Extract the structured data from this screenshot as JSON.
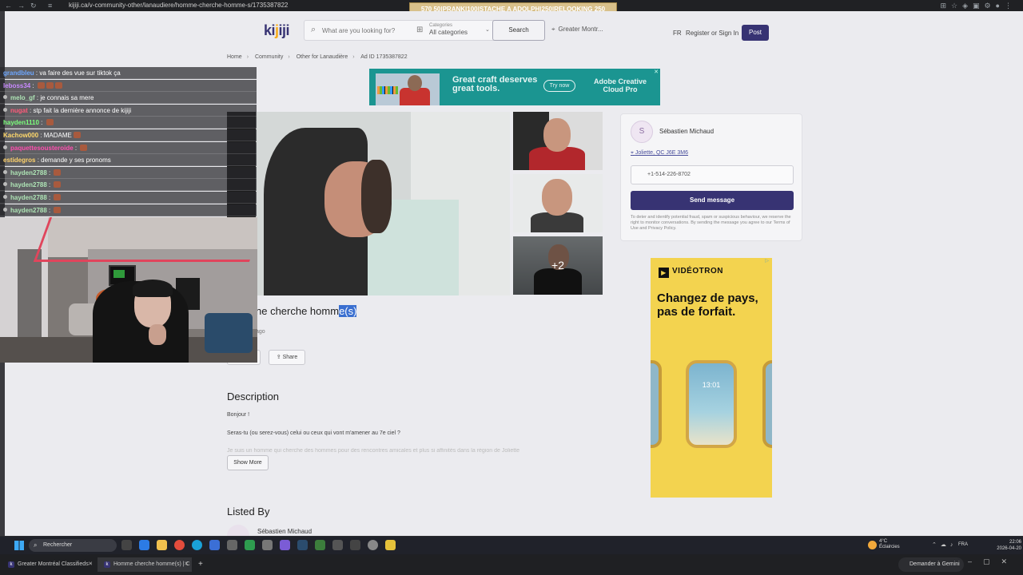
{
  "browser": {
    "url": "kijiji.ca/v-community-other/lanaudiere/homme-cherche-homme-s/1735387822",
    "overlay_text": "570        50|PRANK|100|STACHE A ADOLPH|250|RELOOKING 250"
  },
  "header": {
    "logo": [
      "ki",
      "j",
      "iji"
    ],
    "search_placeholder": "What are you looking for?",
    "categories_label": "Categories",
    "categories_value": "All categories",
    "search_button": "Search",
    "location": "Greater Montr...",
    "lang": "FR",
    "register": "Register or Sign In",
    "post": "Post"
  },
  "breadcrumb": [
    "Home",
    "Community",
    "Other for Lanaudière",
    "Ad ID 1735387822"
  ],
  "adobe_ad": {
    "headline": "Great craft deserves great tools.",
    "cta": "Try now",
    "brand": "Adobe Creative Cloud Pro"
  },
  "gallery": {
    "more_count": "+2"
  },
  "seller": {
    "initial": "S",
    "name": "Sébastien Michaud",
    "location": "Joliette, QC J6E 3M6",
    "phone": "+1-514-226-8702",
    "send_button": "Send message",
    "disclaimer": "To deter and identify potential fraud, spam or suspicious behaviour, we reserve the right to monitor conversations. By sending the message you agree to our Terms of Use and Privacy Policy."
  },
  "videotron_ad": {
    "brand": "VIDÉOTRON",
    "tagline": "Changez de pays, pas de forfait.",
    "phone_time": "13:01"
  },
  "listing": {
    "title_prefix": "ne cherche homm",
    "title_highlight": "e(s)",
    "posted": "ago",
    "share": "Share",
    "description_heading": "Description",
    "desc_p1": "Bonjour !",
    "desc_p2": "Seras-tu (ou serez-vous) celui ou ceux qui vont m'amener au 7e ciel ?",
    "desc_p3": "Je suis un homme qui cherche des hommes pour des rencontres amicales et plus si affinités dans la région de Joliette",
    "show_more": "Show More",
    "listed_by_heading": "Listed By",
    "listed_by_name": "Sébastien Michaud"
  },
  "chat": [
    {
      "user": "grandbleu",
      "color": "#6da7ff",
      "msg": " : va faire des vue sur tiktok ça",
      "badge": false,
      "icons": 0
    },
    {
      "user": "leboss34",
      "color": "#c889ff",
      "msg": " : ",
      "badge": false,
      "icons": 3
    },
    {
      "user": "melo_gf",
      "color": "#aee4b5",
      "msg": " : je connais sa mere",
      "badge": true,
      "icons": 0
    },
    {
      "user": "nugat",
      "color": "#ff5b7a",
      "msg": " : stp fait la dernière annonce de kijiji",
      "badge": true,
      "icons": 0
    },
    {
      "user": "hayden1110",
      "color": "#7cff7c",
      "msg": " : ",
      "badge": false,
      "icons": 1
    },
    {
      "user": "Kachow000",
      "color": "#ffd86b",
      "msg": " : MADAME",
      "badge": false,
      "icons": 1
    },
    {
      "user": "paquettesousteroide",
      "color": "#ff4fb0",
      "msg": " : ",
      "badge": true,
      "icons": 1
    },
    {
      "user": "estidegros",
      "color": "#ffd26b",
      "msg": " : demande y ses pronoms",
      "badge": false,
      "icons": 0
    },
    {
      "user": "hayden2788",
      "color": "#aee4b5",
      "msg": " : ",
      "badge": true,
      "icons": 1
    },
    {
      "user": "hayden2788",
      "color": "#aee4b5",
      "msg": " : ",
      "badge": true,
      "icons": 1
    },
    {
      "user": "hayden2788",
      "color": "#aee4b5",
      "msg": " : ",
      "badge": true,
      "icons": 1
    },
    {
      "user": "hayden2788",
      "color": "#aee4b5",
      "msg": " : ",
      "badge": true,
      "icons": 1
    }
  ],
  "taskbar": {
    "search": "Rechercher",
    "temp": "4°C",
    "weather": "Éclaircies",
    "lang": "FRA",
    "time": "22:06",
    "date": "2026-04-20"
  },
  "tabs": [
    {
      "label": "Greater Montréal Classifieds - "
    },
    {
      "label": "Homme cherche homme(s) | C"
    }
  ],
  "gemini": "Demander à Gemini"
}
